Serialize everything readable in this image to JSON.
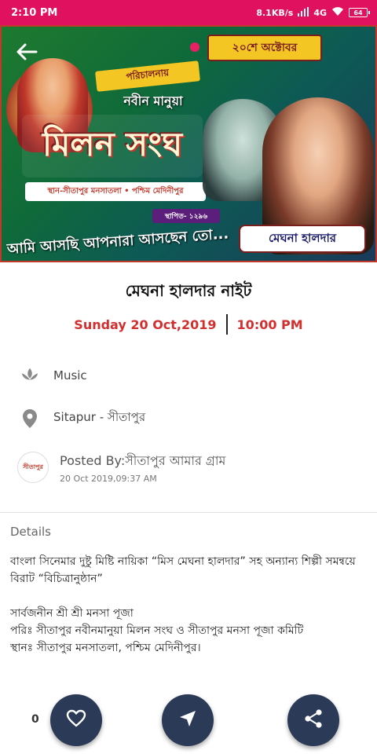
{
  "status_bar": {
    "time": "2:10 PM",
    "network": "8.1KB/s",
    "signal": "4G",
    "battery": "64"
  },
  "banner": {
    "date_pill": "২০শে অক্টোবর",
    "presented_by": "পরিচালনায়",
    "club_small": "নবীন মানুয়া",
    "club_big": "মিলন সংঘ",
    "address": "স্থান-সীতাপুর মনসাতলা • পশ্চিম মেদিনীপুর",
    "established": "স্থাপিত- ১২৯৬",
    "slogan": "আমি আসছি আপনারা আসছেন তো...",
    "name_tag": "মেঘনা হালদার"
  },
  "event": {
    "title": "মেঘনা হালদার নাইট",
    "date": "Sunday 20 Oct,2019",
    "time": "10:00 PM",
    "category": "Music",
    "location": "Sitapur - সীতাপুর"
  },
  "poster": {
    "avatar_text": "সীতাপুর",
    "posted_by": "Posted By:সীতাপুর আমার গ্রাম",
    "posted_time": "20 Oct 2019,09:37 AM"
  },
  "details": {
    "label": "Details",
    "para1": "বাংলা সিনেমার দুষ্টু মিষ্টি নায়িকা “মিস মেঘনা হালদার” সহ অন্যান্য শিল্পী সমন্বয়ে বিরাট “বিচিত্রানুষ্ঠান”",
    "line1": "সার্বজনীন শ্রী শ্রী মনসা পূজা",
    "line2": "পরিঃ সীতাপুর নবীনমানুয়া মিলন সংঘ ও সীতাপুর মনসা পূজা কমিটি",
    "line3": "স্থানঃ সীতাপুর মনসাতলা, পশ্চিম মেদিনীপুর।"
  },
  "actions": {
    "like_count": "0"
  },
  "colors": {
    "status_bar": "#e0115f",
    "accent_red": "#d32f2f",
    "fab": "#2b3a56"
  }
}
